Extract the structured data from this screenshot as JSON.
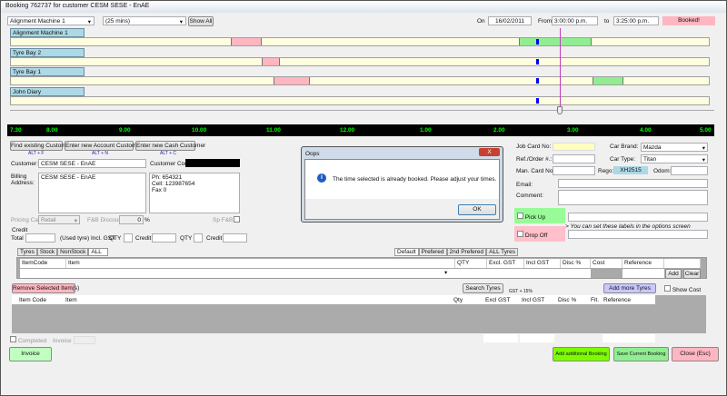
{
  "window": {
    "title": "Booking 762737 for customer CESM SESE - EnAE"
  },
  "toolbar": {
    "resource_select": "Alignment Machine 1",
    "duration_select": "(25 mins)",
    "show_all": "Show All",
    "on_label": "On",
    "date": "16/02/2011",
    "from_label": "From",
    "from_time": "3:00:00 p.m.",
    "to_label": "to",
    "to_time": "3:25:00 p.m.",
    "status": "Booked!"
  },
  "resources": [
    {
      "label": "Alignment Machine 1"
    },
    {
      "label": "Tyre Bay 2"
    },
    {
      "label": "Tyre Bay 1"
    },
    {
      "label": "John Diary"
    }
  ],
  "timeline": {
    "ticks": [
      "7.30",
      "8.00",
      "9.00",
      "10.00",
      "11.00",
      "12.00",
      "1.00",
      "2.00",
      "3.00",
      "4.00",
      "5.00"
    ]
  },
  "customer_buttons": {
    "find": "Find existing Customer",
    "find_hint": "ALT + F",
    "new_account": "Enter new Account Customer",
    "new_account_hint": "ALT + N",
    "new_cash": "Enter new Cash Customer",
    "new_cash_hint": "ALT + C"
  },
  "customer": {
    "customer_label": "Customer:",
    "customer_value": "CESM SESE - EnAE",
    "code_label": "Customer Code:",
    "billing_label": "Billing Address:",
    "billing_value": "CESM SESE - EnAE",
    "phone": "Ph: 654321",
    "cell": "Cell: 123987654",
    "fax": "Fax 0",
    "pricing_label": "Pricing Cat:",
    "pricing_value": "Retail",
    "fb_label": "F&B Discount:",
    "fb_value": "0",
    "pct": "%",
    "spfb_label": "Sp F&B"
  },
  "credit": {
    "group": "Credit",
    "total": "Total",
    "used": "(Used tyre) Incl. GST",
    "qty1": "QTY",
    "credit1": "Credit",
    "qty2": "QTY",
    "credit2": "Credit"
  },
  "dialog": {
    "title": "Oops",
    "message": "The time selected is already booked. Please adjust your times.",
    "ok": "OK",
    "close": "X"
  },
  "vehicle": {
    "job_card_label": "Job Card No:",
    "ref_label": "Ref./Order #.:",
    "man_card_label": "Man. Card No:",
    "brand_label": "Car Brand:",
    "brand_value": "Mazda",
    "type_label": "Car Type:",
    "type_value": "Titan",
    "rego_label": "Rego:",
    "rego_value": "XH2515",
    "odom_label": "Odom:",
    "email_label": "Email:",
    "comment_label": "Comment:",
    "pickup": "Pick Up",
    "dropoff": "Drop Off",
    "labels_hint": "> You can set these labels in the options screen"
  },
  "item_tabs": [
    "Tyres",
    "Stock",
    "NonStock",
    "ALL"
  ],
  "price_tabs": [
    "Default",
    "Prefered",
    "2nd Prefered",
    "ALL Tyres"
  ],
  "entry_grid": {
    "columns": [
      "ItemCode",
      "Item",
      "QTY",
      "Excl. GST",
      "Incl GST",
      "Disc %",
      "Cost",
      "Reference"
    ],
    "add": "Add",
    "clear": "Clear"
  },
  "actions": {
    "remove": "Remove Selected Item(s)",
    "search_tyres": "Search Tyres",
    "gst": "GST + 15%",
    "add_more": "Add more Tyres",
    "show_cost": "Show Cost"
  },
  "items_grid": {
    "columns": [
      "Item Code",
      "Item",
      "Qty",
      "Excl GST",
      "Incl GST",
      "Disc %",
      "Fit.",
      "Reference"
    ]
  },
  "footer": {
    "completed": "Completed",
    "invoice_label": "Invoice",
    "invoice_btn": "Invoice",
    "add_booking": "Add additional Booking",
    "save": "Save Current Booking",
    "close": "Close (Esc)"
  },
  "colors": {
    "booked": "#ffb6c1",
    "free": "#90ee90",
    "timeline_text": "#00ff00",
    "resource": "#add8e6"
  }
}
